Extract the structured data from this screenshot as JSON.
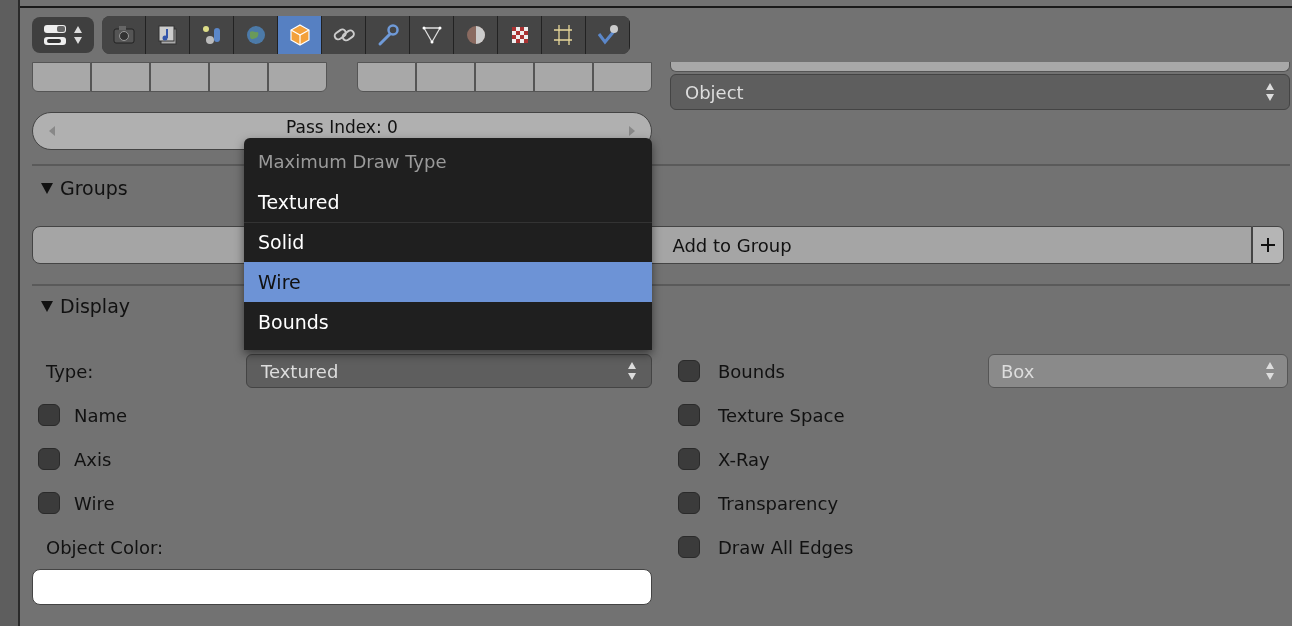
{
  "toolbar": {
    "tabs": [
      {
        "selected": false
      },
      {
        "selected": false
      },
      {
        "selected": false
      },
      {
        "selected": false
      },
      {
        "selected": true
      },
      {
        "selected": false
      },
      {
        "selected": false
      },
      {
        "selected": false
      },
      {
        "selected": false
      },
      {
        "selected": false
      },
      {
        "selected": false
      },
      {
        "selected": false
      }
    ]
  },
  "relations": {
    "pass_index": "Pass Index: 0",
    "parent_type": "Object"
  },
  "groups": {
    "title": "Groups",
    "expanded": true,
    "add_button": "Add to Group"
  },
  "display": {
    "title": "Display",
    "expanded": true,
    "type_label": "Type:",
    "type_value": "Textured",
    "bounds": {
      "label": "Bounds",
      "checked": false
    },
    "bounds_type": "Box",
    "left_options": [
      {
        "label": "Name",
        "checked": false
      },
      {
        "label": "Axis",
        "checked": false
      },
      {
        "label": "Wire",
        "checked": false
      }
    ],
    "right_options": [
      {
        "label": "Texture Space",
        "checked": false
      },
      {
        "label": "X-Ray",
        "checked": false
      },
      {
        "label": "Transparency",
        "checked": false
      },
      {
        "label": "Draw All Edges",
        "checked": false
      }
    ],
    "object_color_label": "Object Color:"
  },
  "menu": {
    "title": "Maximum Draw Type",
    "items": [
      {
        "label": "Textured",
        "selected": false
      },
      {
        "label": "Solid",
        "selected": false
      },
      {
        "label": "Wire",
        "selected": true
      },
      {
        "label": "Bounds",
        "selected": false
      }
    ]
  }
}
